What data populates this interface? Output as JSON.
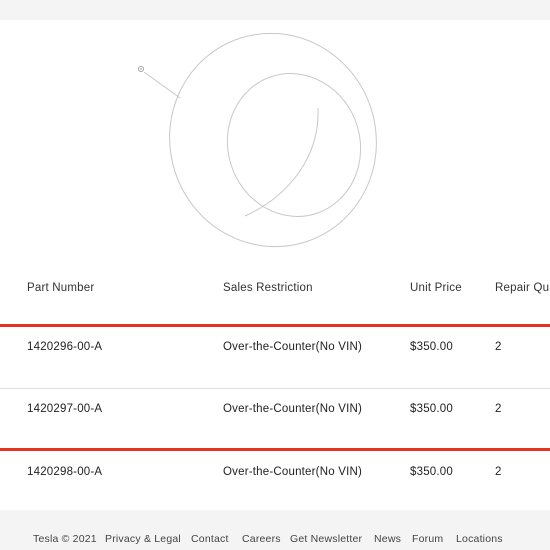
{
  "table": {
    "headers": {
      "part_number": "Part Number",
      "sales_restriction": "Sales Restriction",
      "unit_price": "Unit Price",
      "repair_qty": "Repair Qu"
    },
    "rows": [
      {
        "part_number": "1420296-00-A",
        "sales_restriction": "Over-the-Counter(No VIN)",
        "unit_price": "$350.00",
        "repair_qty": "2"
      },
      {
        "part_number": "1420297-00-A",
        "sales_restriction": "Over-the-Counter(No VIN)",
        "unit_price": "$350.00",
        "repair_qty": "2"
      },
      {
        "part_number": "1420298-00-A",
        "sales_restriction": "Over-the-Counter(No VIN)",
        "unit_price": "$350.00",
        "repair_qty": "2"
      }
    ]
  },
  "highlight_color": "#e8321f",
  "footer": {
    "copyright": "Tesla © 2021",
    "links": [
      "Privacy & Legal",
      "Contact",
      "Careers",
      "Get Newsletter",
      "News",
      "Forum",
      "Locations"
    ]
  }
}
